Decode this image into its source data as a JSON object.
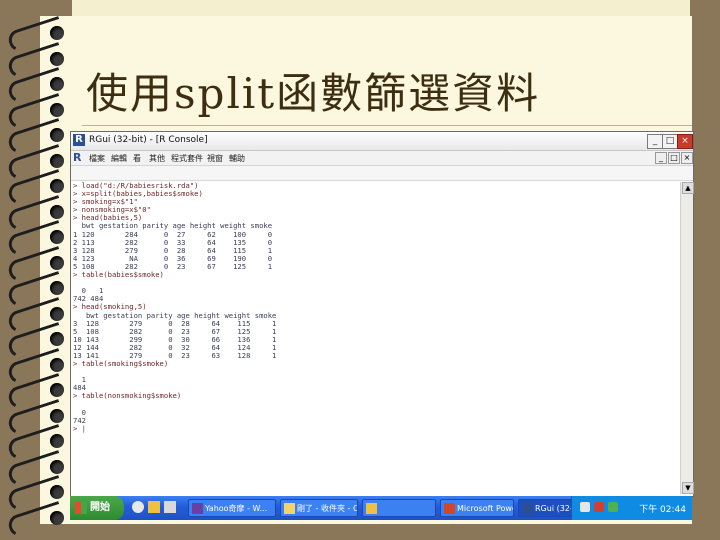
{
  "slide": {
    "title": "使用split函數篩選資料"
  },
  "window": {
    "title": "RGui (32-bit) - [R Console]",
    "menu": [
      "檔案",
      "編輯",
      "看",
      "其他",
      "程式套件",
      "視窗",
      "輔助"
    ],
    "controls": {
      "minimize": "_",
      "maximize": "□",
      "close": "×"
    }
  },
  "console": {
    "lines": [
      {
        "kind": "cmd",
        "text": "> load(\"d:/R/babiesrisk.rda\")"
      },
      {
        "kind": "cmd",
        "text": "> x=split(babies,babies$smoke)"
      },
      {
        "kind": "cmd",
        "text": "> smoking=x$\"1\""
      },
      {
        "kind": "cmd",
        "text": "> nonsmoking=x$\"0\""
      },
      {
        "kind": "cmd",
        "text": "> head(babies,5)"
      },
      {
        "kind": "out",
        "text": "  bwt gestation parity age height weight smoke"
      },
      {
        "kind": "out",
        "text": "1 120       284      0  27     62    100     0"
      },
      {
        "kind": "out",
        "text": "2 113       282      0  33     64    135     0"
      },
      {
        "kind": "out",
        "text": "3 128       279      0  28     64    115     1"
      },
      {
        "kind": "out",
        "text": "4 123        NA      0  36     69    190     0"
      },
      {
        "kind": "out",
        "text": "5 108       282      0  23     67    125     1"
      },
      {
        "kind": "cmd",
        "text": "> table(babies$smoke)"
      },
      {
        "kind": "out",
        "text": ""
      },
      {
        "kind": "out",
        "text": "  0   1"
      },
      {
        "kind": "out",
        "text": "742 484"
      },
      {
        "kind": "cmd",
        "text": "> head(smoking,5)"
      },
      {
        "kind": "out",
        "text": "   bwt gestation parity age height weight smoke"
      },
      {
        "kind": "out",
        "text": "3  128       279      0  28     64    115     1"
      },
      {
        "kind": "out",
        "text": "5  108       282      0  23     67    125     1"
      },
      {
        "kind": "out",
        "text": "10 143       299      0  30     66    136     1"
      },
      {
        "kind": "out",
        "text": "12 144       282      0  32     64    124     1"
      },
      {
        "kind": "out",
        "text": "13 141       279      0  23     63    128     1"
      },
      {
        "kind": "cmd",
        "text": "> table(smoking$smoke)"
      },
      {
        "kind": "out",
        "text": ""
      },
      {
        "kind": "out",
        "text": "  1"
      },
      {
        "kind": "out",
        "text": "484"
      },
      {
        "kind": "cmd",
        "text": "> table(nonsmoking$smoke)"
      },
      {
        "kind": "out",
        "text": ""
      },
      {
        "kind": "out",
        "text": "  0"
      },
      {
        "kind": "out",
        "text": "742"
      },
      {
        "kind": "cmd",
        "text": "> |"
      }
    ]
  },
  "taskbar": {
    "start_label": "開始",
    "tasks": [
      {
        "label": "Yahoo奇摩 - W...",
        "active": false
      },
      {
        "label": "剛了 - 收件夾 - Outl...",
        "active": false
      },
      {
        "label": "",
        "active": false
      },
      {
        "label": "Microsoft Power...",
        "active": false
      },
      {
        "label": "RGui (32-bit) - [...",
        "active": true
      }
    ],
    "clock": "下午 02:44"
  },
  "colors": {
    "page": "#fbf8df",
    "frame": "#8a7659",
    "title_text": "#3d2e12",
    "taskbar": "#245edb",
    "start": "#2f8a2f",
    "tray": "#0f8be4"
  }
}
